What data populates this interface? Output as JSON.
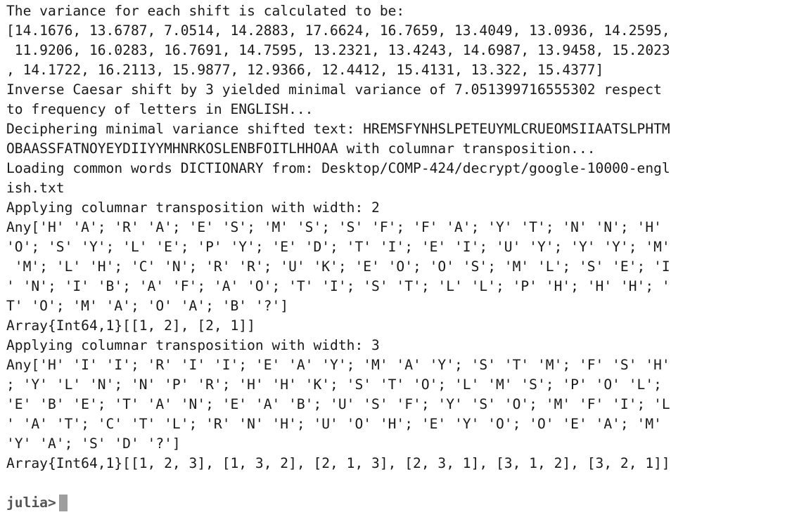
{
  "terminal": {
    "lines": [
      "The variance for each shift is calculated to be:",
      "[14.1676, 13.6787, 7.0514, 14.2883, 17.6624, 16.7659, 13.4049, 13.0936, 14.2595,",
      " 11.9206, 16.0283, 16.7691, 14.7595, 13.2321, 13.4243, 14.6987, 13.9458, 15.2023",
      ", 14.1722, 16.2113, 15.9877, 12.9366, 12.4412, 15.4131, 13.322, 15.4377]",
      "Inverse Caesar shift by 3 yielded minimal variance of 7.051399716555302 respect",
      "to frequency of letters in ENGLISH...",
      "Deciphering minimal variance shifted text: HREMSFYNHSLPETEUYMLCRUEOMSIIAATSLPHTM",
      "OBAASSFATNOYEYDIIYYMHNRKOSLENBFOITLHHOAA with columnar transposition...",
      "Loading common words DICTIONARY from: Desktop/COMP-424/decrypt/google-10000-engl",
      "ish.txt",
      "Applying columnar transposition with width: 2",
      "Any['H' 'A'; 'R' 'A'; 'E' 'S'; 'M' 'S'; 'S' 'F'; 'F' 'A'; 'Y' 'T'; 'N' 'N'; 'H'",
      "'O'; 'S' 'Y'; 'L' 'E'; 'P' 'Y'; 'E' 'D'; 'T' 'I'; 'E' 'I'; 'U' 'Y'; 'Y' 'Y'; 'M'",
      " 'M'; 'L' 'H'; 'C' 'N'; 'R' 'R'; 'U' 'K'; 'E' 'O'; 'O' 'S'; 'M' 'L'; 'S' 'E'; 'I",
      "' 'N'; 'I' 'B'; 'A' 'F'; 'A' 'O'; 'T' 'I'; 'S' 'T'; 'L' 'L'; 'P' 'H'; 'H' 'H'; '",
      "T' 'O'; 'M' 'A'; 'O' 'A'; 'B' '?']",
      "Array{Int64,1}[[1, 2], [2, 1]]",
      "Applying columnar transposition with width: 3",
      "Any['H' 'I' 'I'; 'R' 'I' 'I'; 'E' 'A' 'Y'; 'M' 'A' 'Y'; 'S' 'T' 'M'; 'F' 'S' 'H'",
      "; 'Y' 'L' 'N'; 'N' 'P' 'R'; 'H' 'H' 'K'; 'S' 'T' 'O'; 'L' 'M' 'S'; 'P' 'O' 'L';",
      "'E' 'B' 'E'; 'T' 'A' 'N'; 'E' 'A' 'B'; 'U' 'S' 'F'; 'Y' 'S' 'O'; 'M' 'F' 'I'; 'L",
      "' 'A' 'T'; 'C' 'T' 'L'; 'R' 'N' 'H'; 'U' 'O' 'H'; 'E' 'Y' 'O'; 'O' 'E' 'A'; 'M'",
      "'Y' 'A'; 'S' 'D' '?']",
      "Array{Int64,1}[[1, 2, 3], [1, 3, 2], [2, 1, 3], [2, 3, 1], [3, 1, 2], [3, 2, 1]]"
    ],
    "prompt": "julia>"
  }
}
